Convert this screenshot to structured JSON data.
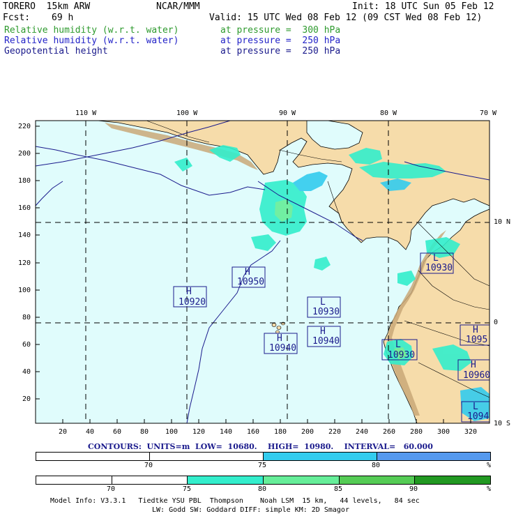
{
  "header": {
    "model": "TORERO  15km ARW",
    "org": "NCAR/MMM",
    "init": "Init: 18 UTC Sun 05 Feb 12",
    "fcst_label": "Fcst:",
    "fcst_value": "69 h",
    "valid": "Valid: 15 UTC Wed 08 Feb 12 (09 CST Wed 08 Feb 12)",
    "fields": [
      {
        "name": "Relative humidity (w.r.t. water)",
        "level": "at pressure =  300 hPa",
        "color": "#2e9a2e"
      },
      {
        "name": "Relative humidity (w.r.t. water)",
        "level": "at pressure =  250 hPa",
        "color": "#2323c8"
      },
      {
        "name": "Geopotential height",
        "level": "at pressure =  250 hPa",
        "color": "#1a1a8c"
      }
    ]
  },
  "map": {
    "lon_labels": [
      "110 W",
      "100 W",
      "90 W",
      "80 W",
      "70 W"
    ],
    "lat_labels": [
      "10 N",
      "0",
      "10 S"
    ],
    "y_ticks": [
      "220",
      "200",
      "180",
      "160",
      "140",
      "120",
      "100",
      "80",
      "60",
      "40",
      "20"
    ],
    "x_ticks": [
      "20",
      "40",
      "60",
      "80",
      "100",
      "120",
      "140",
      "160",
      "180",
      "200",
      "220",
      "240",
      "260",
      "280",
      "300",
      "320"
    ],
    "centers": [
      {
        "type": "H",
        "value": "10950"
      },
      {
        "type": "H",
        "value": "10920"
      },
      {
        "type": "L",
        "value": "10930"
      },
      {
        "type": "L",
        "value": "10930"
      },
      {
        "type": "H",
        "value": "10940"
      },
      {
        "type": "H",
        "value": "10940"
      },
      {
        "type": "L",
        "value": "10930"
      },
      {
        "type": "H",
        "value": "1095"
      },
      {
        "type": "H",
        "value": "10960"
      },
      {
        "type": "L",
        "value": "1094"
      }
    ],
    "colors": {
      "ocean": "#e0fcfc",
      "land_low": "#f6dcaa",
      "land_high": "#c9a878",
      "contour": "#1a1a8c"
    }
  },
  "contour_info": {
    "text": "CONTOURS:  UNITS=m  LOW=  10680.    HIGH=  10980.    INTERVAL=   60.000"
  },
  "colorbar_blue": {
    "labels": [
      "70",
      "75",
      "80",
      "%"
    ],
    "colors": [
      "#ffffff",
      "#ffffff",
      "#33ccee",
      "#5599ee"
    ]
  },
  "colorbar_green": {
    "labels": [
      "70",
      "75",
      "80",
      "85",
      "90",
      "%"
    ],
    "colors": [
      "#ffffff",
      "#ffffff",
      "#33eecc",
      "#66ee99",
      "#55cc55",
      "#229922"
    ]
  },
  "footer": {
    "line1": "Model Info: V3.3.1   Tiedtke YSU PBL  Thompson    Noah LSM  15 km,   44 levels,   84 sec",
    "line2": "LW: Godd SW: Goddard DIFF: simple KM: 2D Smagor"
  }
}
